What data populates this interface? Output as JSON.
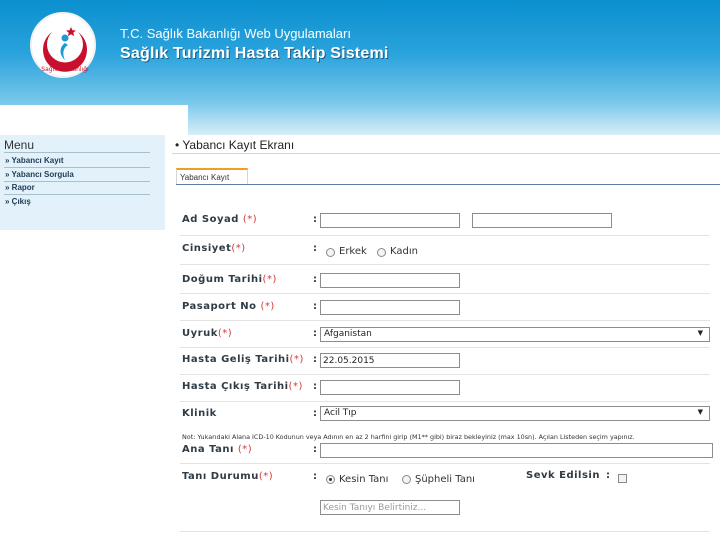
{
  "header": {
    "ministry_title": "T.C. Sağlık Bakanlığı Web Uygulamaları",
    "system_title": "Sağlık Turizmi Hasta Takip Sistemi",
    "logo_text": "Sağlık Bakanlığı"
  },
  "sidebar": {
    "title": "Menu",
    "items": [
      {
        "label": "» Yabancı Kayıt"
      },
      {
        "label": "» Yabancı Sorgula"
      },
      {
        "label": "» Rapor"
      },
      {
        "label": "» Çıkış"
      }
    ]
  },
  "main": {
    "title": "• Yabancı Kayıt Ekranı",
    "tab_label": "Yabancı Kayıt"
  },
  "form": {
    "colon": ":",
    "required_mark": "(*)",
    "ad_soyad_label": "Ad Soyad",
    "cinsiyet_label": "Cinsiyet",
    "gender_options": [
      "Erkek",
      "Kadın"
    ],
    "dogum_tarihi_label": "Doğum Tarihi",
    "pasaport_no_label": "Pasaport No",
    "uyruk_label": "Uyruk",
    "uyruk_value": "Afganistan",
    "gelis_tarihi_label": "Hasta Geliş Tarihi",
    "gelis_tarihi_value": "22.05.2015",
    "cikis_tarihi_label": "Hasta Çıkış Tarihi",
    "klinik_label": "Klinik",
    "klinik_value": "Acil Tıp",
    "note": "Not: Yukarıdaki Alana ICD-10 Kodunun veya Adının en az 2 harfini girip (M1** gibi) biraz bekleyiniz (max 10sn). Açılan Listeden seçim yapınız.",
    "ana_tani_label": "Ana Tanı",
    "tani_durumu_label": "Tanı Durumu",
    "tani_options": [
      "Kesin Tanı",
      "Şüpheli Tanı"
    ],
    "sevk_label": "Sevk Edilsin",
    "kesin_tani_placeholder": "Kesin Tanıyı Belirtiniz..."
  }
}
